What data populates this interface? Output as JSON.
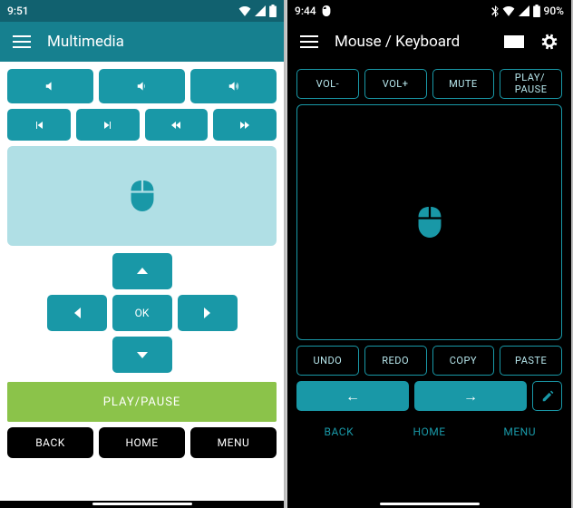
{
  "left": {
    "status": {
      "time": "9:51"
    },
    "appbar": {
      "title": "Multimedia"
    },
    "dpad": {
      "ok": "OK"
    },
    "play": "PLAY/PAUSE",
    "nav": {
      "back": "BACK",
      "home": "HOME",
      "menu": "MENU"
    }
  },
  "right": {
    "status": {
      "time": "9:44",
      "battery": "90%"
    },
    "appbar": {
      "title": "Mouse / Keyboard"
    },
    "media": {
      "volDown": "VOL-",
      "volUp": "VOL+",
      "mute": "MUTE",
      "play": "PLAY/\nPAUSE"
    },
    "edit": {
      "undo": "UNDO",
      "redo": "REDO",
      "copy": "COPY",
      "paste": "PASTE"
    },
    "arrows": {
      "left": "←",
      "right": "→"
    },
    "nav": {
      "back": "BACK",
      "home": "HOME",
      "menu": "MENU"
    }
  }
}
